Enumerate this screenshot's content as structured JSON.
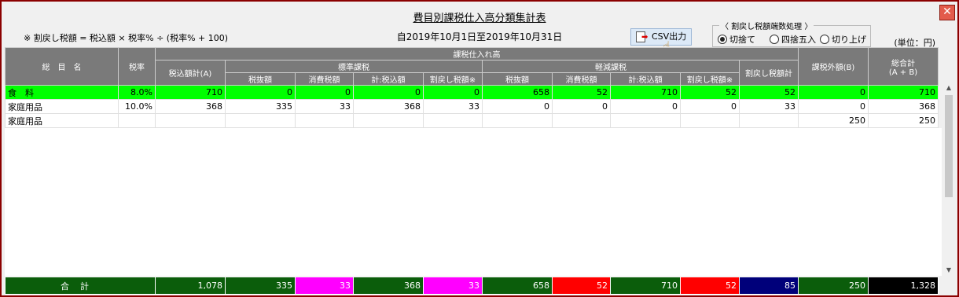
{
  "window": {
    "title": "費目別課税仕入高分類集計表",
    "close_glyph": "✕"
  },
  "formula": "※ 割戻し税額 = 税込額 × 税率% ÷ (税率% + 100)",
  "period": "自2019年10月1日至2019年10月31日",
  "csv_button": {
    "label": "CSV出力"
  },
  "rounding": {
    "legend": "〈 割戻し税額端数処理 〉",
    "options": [
      {
        "label": "切捨て",
        "selected": true
      },
      {
        "label": "四捨五入",
        "selected": false
      },
      {
        "label": "切り上げ",
        "selected": false
      }
    ]
  },
  "unit_label": "(単位：円)",
  "headers": {
    "item_name": "総　目　名",
    "tax_rate": "税率",
    "purchases": "課税仕入れ高",
    "tax_incl_total": "税込額計(A)",
    "standard": "標準課税",
    "reduced": "軽減課税",
    "tax_excl": "税抜額",
    "consumption_tax": "消費税額",
    "subtotal_incl": "計:税込額",
    "rebate_tax": "割戻し税額※",
    "rebate_total": "割戻し税額計",
    "non_taxable": "課税外額(B)",
    "grand_total_1": "総合計",
    "grand_total_2": "(A + B)"
  },
  "rows": [
    {
      "name": "食　料",
      "rate": "8.0%",
      "a": "710",
      "s_ex": "0",
      "s_tax": "0",
      "s_inc": "0",
      "s_reb": "0",
      "r_ex": "658",
      "r_tax": "52",
      "r_inc": "710",
      "r_reb": "52",
      "reb_total": "52",
      "b": "0",
      "total": "710"
    },
    {
      "name": "家庭用品",
      "rate": "10.0%",
      "a": "368",
      "s_ex": "335",
      "s_tax": "33",
      "s_inc": "368",
      "s_reb": "33",
      "r_ex": "0",
      "r_tax": "0",
      "r_inc": "0",
      "r_reb": "0",
      "reb_total": "33",
      "b": "0",
      "total": "368"
    },
    {
      "name": "家庭用品",
      "rate": "",
      "a": "",
      "s_ex": "",
      "s_tax": "",
      "s_inc": "",
      "s_reb": "",
      "r_ex": "",
      "r_tax": "",
      "r_inc": "",
      "r_reb": "",
      "reb_total": "",
      "b": "250",
      "total": "250"
    }
  ],
  "totals": {
    "label": "合計",
    "a": "1,078",
    "s_ex": "335",
    "s_tax": "33",
    "s_inc": "368",
    "s_reb": "33",
    "r_ex": "658",
    "r_tax": "52",
    "r_inc": "710",
    "r_reb": "52",
    "reb_total": "85",
    "b": "250",
    "total": "1,328"
  },
  "colors": {
    "green_row": "#00ff00",
    "total_green": "#0b5d0b",
    "magenta": "#ff00ff",
    "red": "#ff0000",
    "navy": "#00007a",
    "black": "#000000",
    "window_border": "#8b0000"
  }
}
